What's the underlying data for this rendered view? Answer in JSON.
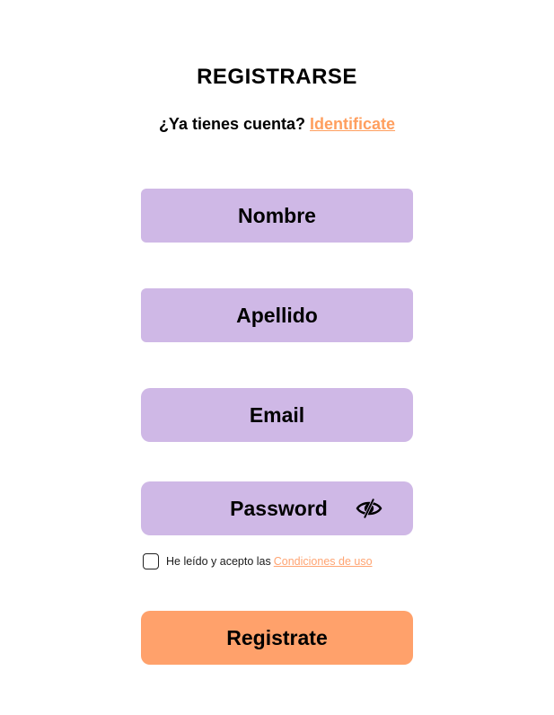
{
  "header": {
    "title": "REGISTRARSE",
    "login_prompt": "¿Ya tienes cuenta?",
    "login_link": "Identificate"
  },
  "form": {
    "name_placeholder": "Nombre",
    "surname_placeholder": "Apellido",
    "email_placeholder": "Email",
    "password_placeholder": "Password",
    "password_toggle_icon": "eye-slash-icon",
    "terms_text": "He leído y acepto las",
    "terms_link": "Condiciones de uso",
    "terms_checked": false,
    "submit_label": "Registrate"
  },
  "colors": {
    "field_background": "#cfb8e6",
    "accent": "#ff9f5f",
    "submit_background": "#ffa16b"
  }
}
